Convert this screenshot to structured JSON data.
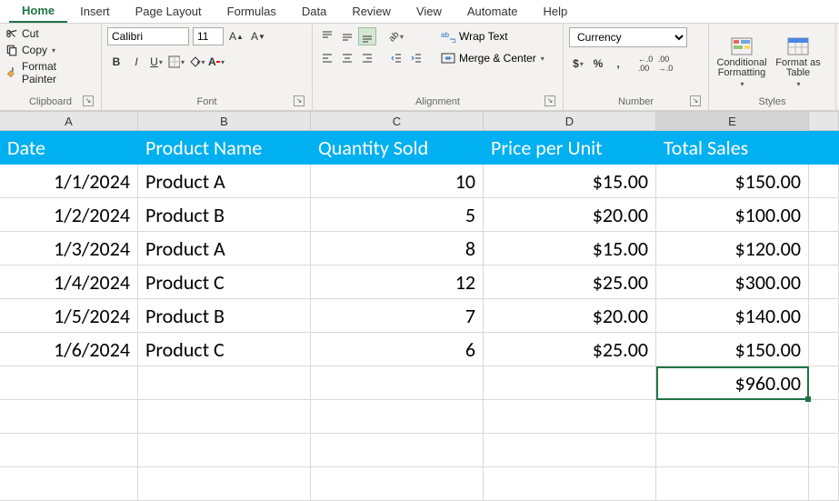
{
  "tabs": {
    "items": [
      "Home",
      "Insert",
      "Page Layout",
      "Formulas",
      "Data",
      "Review",
      "View",
      "Automate",
      "Help"
    ],
    "active": 0
  },
  "clipboard": {
    "cut": "Cut",
    "copy": "Copy",
    "format_painter": "Format Painter",
    "group_label": "Clipboard"
  },
  "font": {
    "name": "Calibri",
    "size": "11",
    "group_label": "Font"
  },
  "alignment": {
    "wrap_text": "Wrap Text",
    "merge_center": "Merge & Center",
    "group_label": "Alignment"
  },
  "number": {
    "format": "Currency",
    "group_label": "Number"
  },
  "styles": {
    "conditional": "Conditional Formatting",
    "format_table": "Format as Table",
    "group_label": "Styles"
  },
  "columns": [
    "A",
    "B",
    "C",
    "D",
    "E"
  ],
  "sheet": {
    "headers": {
      "date": "Date",
      "product": "Product Name",
      "qty": "Quantity Sold",
      "price": "Price per Unit",
      "total": "Total Sales"
    },
    "rows": [
      {
        "date": "1/1/2024",
        "product": "Product A",
        "qty": "10",
        "price": "$15.00",
        "total": "$150.00"
      },
      {
        "date": "1/2/2024",
        "product": "Product B",
        "qty": "5",
        "price": "$20.00",
        "total": "$100.00"
      },
      {
        "date": "1/3/2024",
        "product": "Product A",
        "qty": "8",
        "price": "$15.00",
        "total": "$120.00"
      },
      {
        "date": "1/4/2024",
        "product": "Product C",
        "qty": "12",
        "price": "$25.00",
        "total": "$300.00"
      },
      {
        "date": "1/5/2024",
        "product": "Product B",
        "qty": "7",
        "price": "$20.00",
        "total": "$140.00"
      },
      {
        "date": "1/6/2024",
        "product": "Product C",
        "qty": "6",
        "price": "$25.00",
        "total": "$150.00"
      }
    ],
    "sum_total": "$960.00"
  }
}
